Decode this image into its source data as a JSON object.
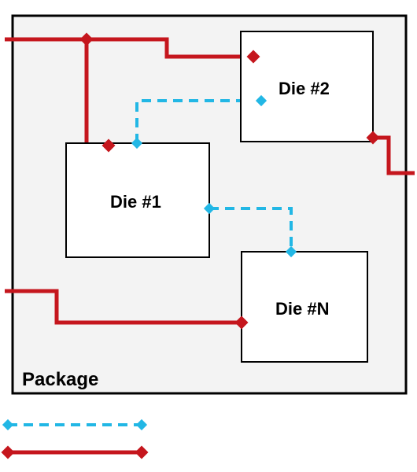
{
  "diagram": {
    "package_label": "Package",
    "dies": {
      "d1": "Die #1",
      "d2": "Die #2",
      "dn": "Die #N"
    },
    "legend": {
      "internal": "",
      "external": ""
    },
    "colors": {
      "external": "#c5161d",
      "internal": "#22b7e5",
      "box_stroke": "#000000",
      "package_fill": "#f3f3f3"
    }
  }
}
